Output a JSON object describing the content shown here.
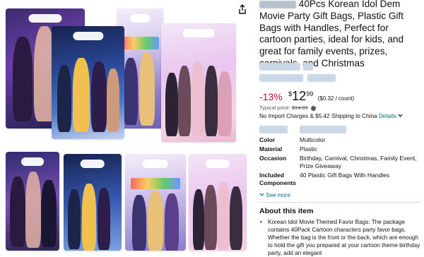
{
  "product": {
    "title_visible": "40Pcs Korean Idol Dem Movie Party Gift Bags, Plastic Gift Bags with Handles, Perfect for cartoon parties, ideal for kids, and great for family events, prizes, carnivals, and Christmas"
  },
  "price": {
    "discount": "-13%",
    "currency": "$",
    "whole": "12",
    "fraction": "99",
    "per_unit": "($0.32 / count)",
    "typical_label": "Typical price:",
    "typical_value": "$14.99"
  },
  "shipping": {
    "text": "No Import Charges & $5.42 Shipping to China",
    "details_link": "Details"
  },
  "specs": [
    {
      "key": "Color",
      "value": "Multicolor"
    },
    {
      "key": "Material",
      "value": "Plastic"
    },
    {
      "key": "Occasion",
      "value": "Birthday, Carnival, Christmas, Family Event, Prize Giveaway"
    },
    {
      "key": "Included Components",
      "value": "40 Plastic Gift Bags With Handles"
    }
  ],
  "see_more": "See more",
  "about": {
    "heading": "About this item",
    "bullet1": "Korean Idol Movie Themed Favor Bags: The package contains 40Pack Cartoon characters party favor bags. Whether the bag is the front or the back, which are enough to hold the gift you prepared at your cartoon theme birthday party, add an elegant"
  },
  "icons": {
    "share": "share-icon",
    "info": "info-icon",
    "chevron": "chevron-down-icon"
  },
  "colors": {
    "discount_red": "#cc0c39",
    "link_teal": "#007185"
  }
}
